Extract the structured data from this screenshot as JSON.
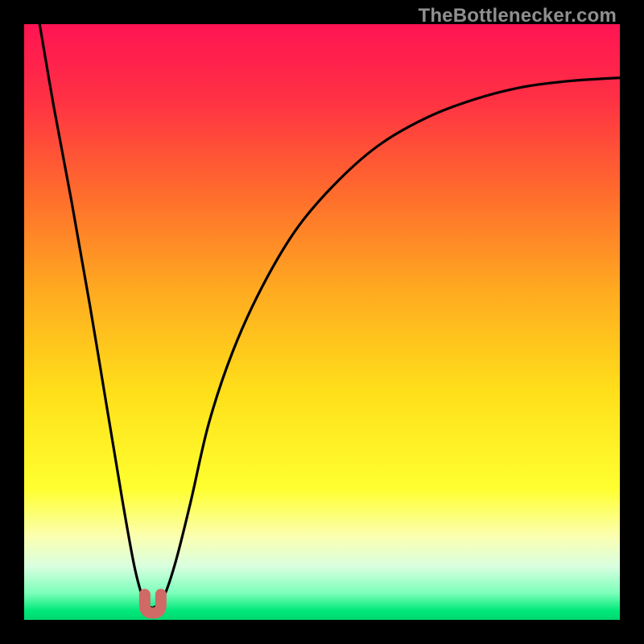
{
  "watermark": "TheBottlenecker.com",
  "colors": {
    "frame": "#000000",
    "curve": "#000000",
    "marker": "#cf6a66",
    "gradient_stops": [
      {
        "offset": 0.0,
        "color": "#ff1453"
      },
      {
        "offset": 0.12,
        "color": "#ff2f45"
      },
      {
        "offset": 0.28,
        "color": "#ff6a2d"
      },
      {
        "offset": 0.45,
        "color": "#ffab20"
      },
      {
        "offset": 0.62,
        "color": "#ffe01a"
      },
      {
        "offset": 0.78,
        "color": "#ffff30"
      },
      {
        "offset": 0.86,
        "color": "#fbffb0"
      },
      {
        "offset": 0.91,
        "color": "#d9ffe0"
      },
      {
        "offset": 0.955,
        "color": "#7cffba"
      },
      {
        "offset": 0.985,
        "color": "#00e87a"
      },
      {
        "offset": 1.0,
        "color": "#00d870"
      }
    ]
  },
  "chart_data": {
    "type": "line",
    "title": "",
    "xlabel": "",
    "ylabel": "",
    "xlim": [
      0,
      1
    ],
    "ylim": [
      0,
      1
    ],
    "series": [
      {
        "name": "bottleneck-curve",
        "x": [
          0.026,
          0.05,
          0.08,
          0.11,
          0.14,
          0.165,
          0.185,
          0.2,
          0.21,
          0.22,
          0.235,
          0.255,
          0.28,
          0.31,
          0.35,
          0.4,
          0.46,
          0.53,
          0.6,
          0.68,
          0.76,
          0.84,
          0.92,
          1.0
        ],
        "y": [
          1.0,
          0.86,
          0.7,
          0.53,
          0.35,
          0.2,
          0.09,
          0.035,
          0.022,
          0.022,
          0.04,
          0.1,
          0.2,
          0.33,
          0.45,
          0.56,
          0.66,
          0.74,
          0.8,
          0.845,
          0.875,
          0.895,
          0.905,
          0.91
        ]
      }
    ],
    "annotations": [
      {
        "name": "optimal-marker",
        "x": 0.216,
        "y": 0.025
      }
    ]
  }
}
